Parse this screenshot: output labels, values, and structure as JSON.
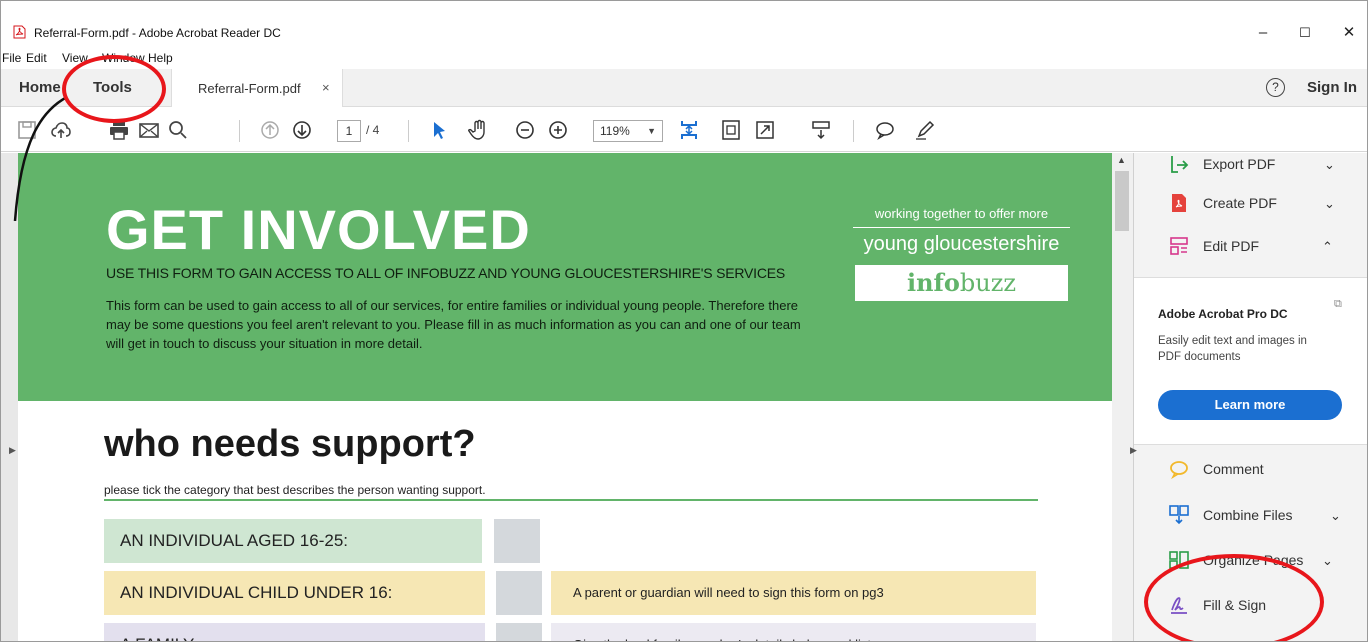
{
  "window": {
    "title": "Referral-Form.pdf - Adobe Acrobat Reader DC",
    "minimize": "–",
    "maximize": "☐",
    "close": "✕"
  },
  "menu": [
    "File",
    "Edit",
    "View",
    "Window",
    "Help"
  ],
  "tabs": {
    "home": "Home",
    "tools": "Tools",
    "document": "Referral-Form.pdf",
    "close": "×",
    "help": "?",
    "sign_in": "Sign In"
  },
  "toolbar": {
    "icons": [
      "save-icon",
      "upload-icon",
      "print-icon",
      "email-icon",
      "search-icon",
      "page-up-icon",
      "page-down-icon",
      "select-icon",
      "hand-icon",
      "zoom-out-icon",
      "zoom-in-icon",
      "fit-page-icon",
      "fit-width-icon",
      "full-screen-icon",
      "read-mode-icon",
      "comment-icon",
      "pen-icon"
    ],
    "page_current": "1",
    "page_total": "/ 4",
    "zoom": "119%"
  },
  "document": {
    "banner_title": "GET INVOLVED",
    "banner_subtitle": "USE THIS FORM TO GAIN ACCESS TO ALL OF INFOBUZZ AND YOUNG GLOUCESTERSHIRE'S SERVICES",
    "banner_body": "This form can be used to gain access to all of our services, for entire families or individual young people. Therefore there may be some questions you feel aren't relevant to you. Please fill in as much information as you can and one of our team will get in touch to discuss your situation in more detail.",
    "logo_tagline": "working together to offer more",
    "logo_name": "young gloucestershire",
    "logo_info": "info",
    "logo_buzz": "buzz",
    "section_title": "who needs support?",
    "section_subtitle": "please tick the category that best describes the person wanting support.",
    "options": [
      {
        "label": "AN INDIVIDUAL AGED 16-25:",
        "color": "#cfe6d2"
      },
      {
        "label": "AN INDIVIDUAL CHILD UNDER 16:",
        "color": "#f6e7b4"
      },
      {
        "label": "A FAMILY:",
        "color": "#e3e0ee"
      }
    ],
    "notes": [
      "A parent or guardian will need to sign this form on pg3",
      "Give the lead family member's details below and list"
    ]
  },
  "right_panel": {
    "tools_top": [
      {
        "label": "Export PDF",
        "icon": "export-pdf-icon",
        "chevron": "⌄"
      },
      {
        "label": "Create PDF",
        "icon": "create-pdf-icon",
        "chevron": "⌄"
      },
      {
        "label": "Edit PDF",
        "icon": "edit-pdf-icon",
        "chevron": "⌃"
      }
    ],
    "promo": {
      "title": "Adobe Acrobat Pro DC",
      "text": "Easily edit text and images in PDF documents",
      "button": "Learn more"
    },
    "tools_bottom": [
      {
        "label": "Comment",
        "icon": "comment-icon"
      },
      {
        "label": "Combine Files",
        "icon": "combine-files-icon",
        "chevron": "⌄"
      },
      {
        "label": "Organize Pages",
        "icon": "organize-pages-icon",
        "chevron": "⌄"
      },
      {
        "label": "Fill & Sign",
        "icon": "fill-sign-icon"
      }
    ]
  },
  "colors": {
    "banner_green": "#62b46a",
    "annotation_red": "#e8161b",
    "accent_blue": "#1b6fd1"
  }
}
